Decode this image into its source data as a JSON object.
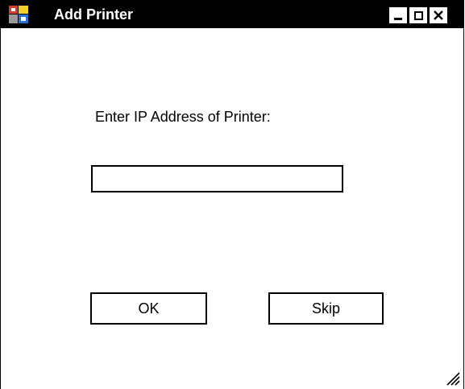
{
  "window": {
    "title": "Add Printer",
    "app_icon": "printer-app-icon",
    "controls": {
      "minimize": "minimize-icon",
      "maximize": "maximize-icon",
      "close": "close-icon"
    }
  },
  "form": {
    "prompt": "Enter IP Address of Printer:",
    "ip_value": "",
    "ip_placeholder": ""
  },
  "buttons": {
    "ok_label": "OK",
    "skip_label": "Skip"
  },
  "colors": {
    "titlebar": "#000000",
    "background": "#ffffff",
    "icon_red": "#e03a2a",
    "icon_yellow": "#f2d12a",
    "icon_blue": "#2a6fd6",
    "icon_gray": "#9a9a9a"
  }
}
